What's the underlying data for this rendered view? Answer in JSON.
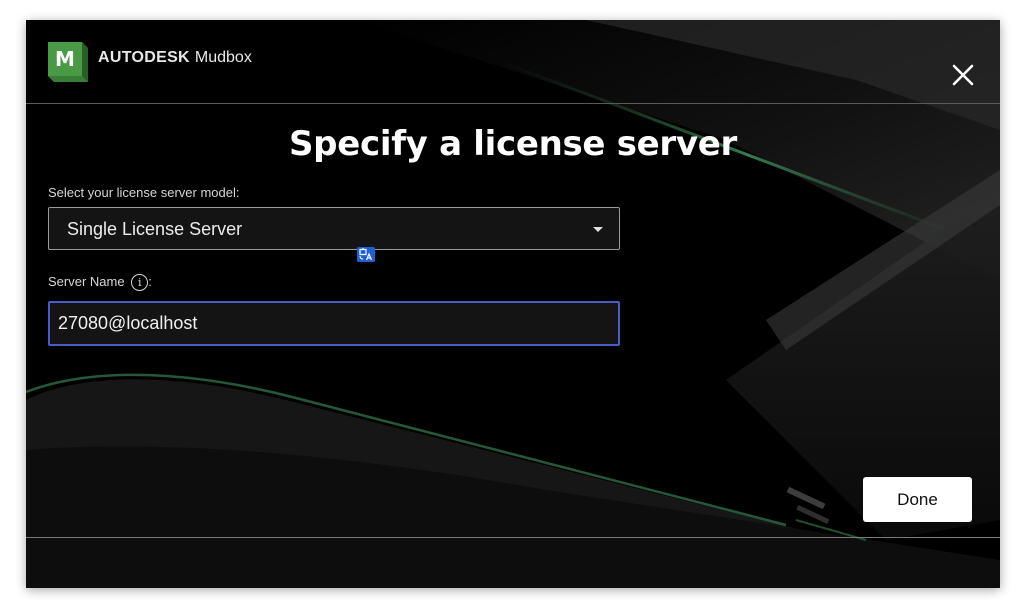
{
  "brand": {
    "logo_letter": "M",
    "company": "AUTODESK",
    "product": "Mudbox",
    "logo_color": "#3f8f3c"
  },
  "header": {
    "close_icon": "close-icon"
  },
  "title": "Specify a license server",
  "license_model": {
    "label": "Select your license server model:",
    "value": "Single License Server",
    "icon": "caret-down-icon"
  },
  "server_name": {
    "label": "Server Name",
    "label_suffix": ":",
    "info_icon": "i",
    "value": "27080@localhost"
  },
  "actions": {
    "done_label": "Done"
  },
  "colors": {
    "background": "#000000",
    "accent_green": "#3f8f3c",
    "input_focus_border": "#4a5cc8",
    "translate_badge": "#1f5fd6"
  }
}
